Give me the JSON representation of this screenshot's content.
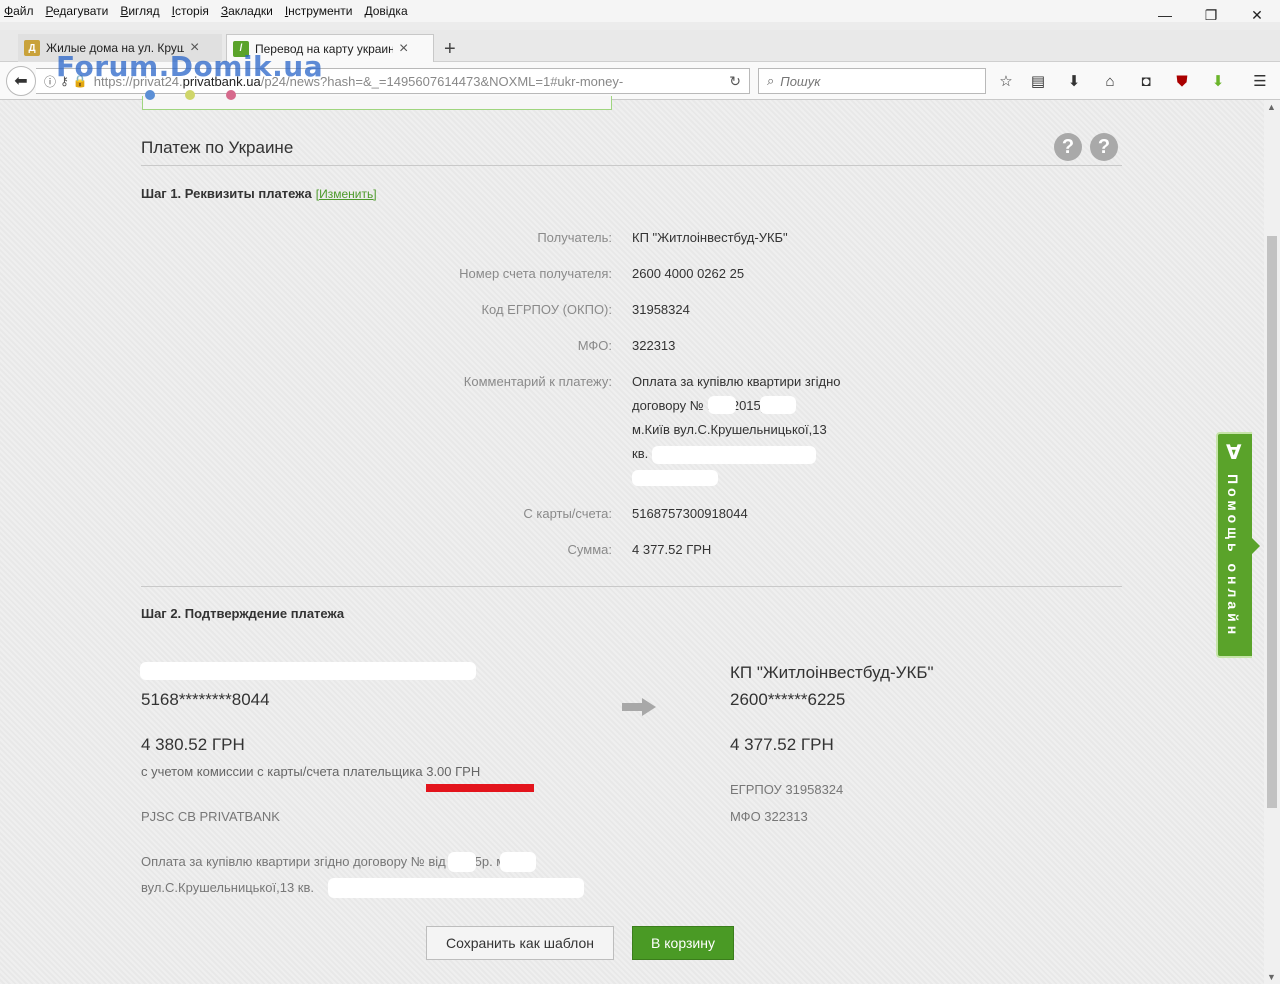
{
  "menu": [
    "Файл",
    "Редагувати",
    "Вигляд",
    "Історія",
    "Закладки",
    "Інструменти",
    "Довідка"
  ],
  "tabs": [
    {
      "title": "Жилые дома на ул. Круше",
      "close": "×"
    },
    {
      "title": "Перевод на карту украинск",
      "close": "×"
    }
  ],
  "new_tab": "+",
  "window": {
    "minimize": "—",
    "restore": "❐",
    "close": "✕"
  },
  "url": {
    "prefix": "https://privat24.",
    "domain": "privatbank.ua",
    "path": "/p24/news?hash=&_=1495607614473&NOXML=1#ukr-money-"
  },
  "watermark": "Forum.Domik.ua",
  "search": {
    "placeholder": "Пошук"
  },
  "page": {
    "section_title": "Платеж по Украине",
    "step1": {
      "title": "Шаг 1. Реквизиты платежа",
      "change_link": "[Изменить]"
    },
    "fields": [
      {
        "label": "Получатель:",
        "value": "КП \"Житлоінвестбуд-УКБ\""
      },
      {
        "label": "Номер счета получателя:",
        "value": "2600 4000 0262 25"
      },
      {
        "label": "Код ЕГРПОУ (ОКПО):",
        "value": "31958324"
      },
      {
        "label": "МФО:",
        "value": "322313"
      },
      {
        "label": "Комментарий к платежу:",
        "value_lines": [
          "Оплата за купівлю квартири згідно",
          "договору №       від          .2015р.",
          "м.Київ вул.С.Крушельницької,13",
          "кв."
        ]
      },
      {
        "label": "С карты/счета:",
        "value": "5168757300918044"
      },
      {
        "label": "Сумма:",
        "value": "4 377.52 ГРН"
      }
    ],
    "step2": {
      "title": "Шаг 2. Подтверждение платежа",
      "sender": {
        "card": "5168********8044",
        "amount": "4 380.52 ГРН",
        "commission": "с учетом комиссии с карты/счета плательщика 3.00 ГРН",
        "bank": "PJSC CB PRIVATBANK",
        "comment_line1": "Оплата за купівлю квартири згідно договору №       від          .2015р. м.Київ",
        "comment_line2": "вул.С.Крушельницької,13 кв."
      },
      "recipient": {
        "name": "КП \"Житлоінвестбуд-УКБ\"",
        "account": "2600******6225",
        "amount": "4 377.52 ГРН",
        "egrpou": "ЕГРПОУ 31958324",
        "mfo": "МФО 322313"
      }
    },
    "buttons": {
      "save": "Сохранить как шаблон",
      "cart": "В корзину"
    }
  },
  "help_panel": {
    "logo": "∀",
    "text": "Помощь онлайн"
  },
  "colors": {
    "accent_green": "#4a9a25",
    "highlight_red": "#e3141c"
  }
}
